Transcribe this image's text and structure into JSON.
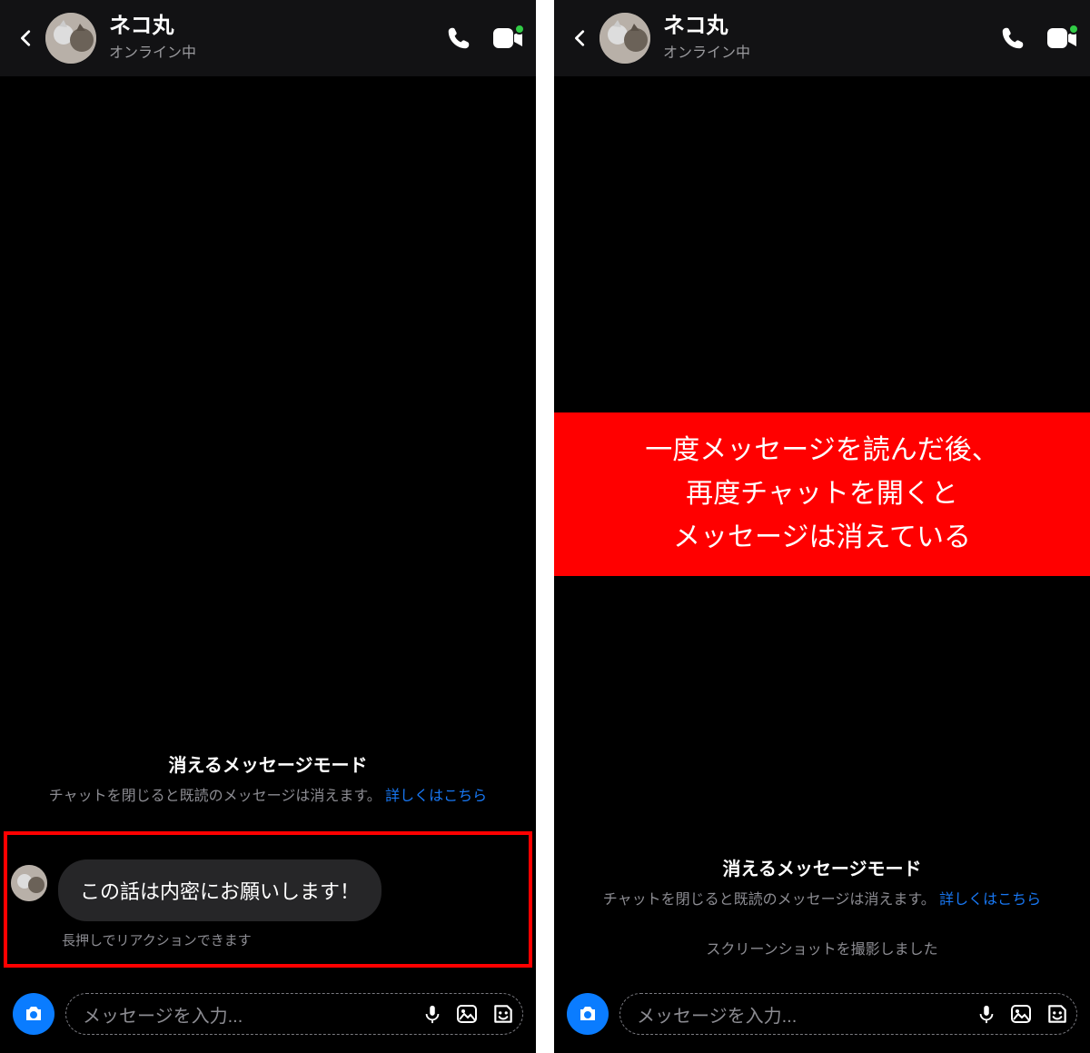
{
  "screens": [
    {
      "header": {
        "username": "ネコ丸",
        "status": "オンライン中"
      },
      "vanish": {
        "title": "消えるメッセージモード",
        "desc_prefix": "チャットを閉じると既読のメッセージは消えます。",
        "link": "詳しくはこちら"
      },
      "message": {
        "bubble": "この話は内密にお願いします！",
        "hint": "長押しでリアクションできます"
      },
      "input_placeholder": "メッセージを入力...",
      "highlight_box": true
    },
    {
      "header": {
        "username": "ネコ丸",
        "status": "オンライン中"
      },
      "vanish": {
        "title": "消えるメッセージモード",
        "desc_prefix": "チャットを閉じると既読のメッセージは消えます。",
        "link": "詳しくはこちら"
      },
      "screenshot_hint": "スクリーンショットを撮影しました",
      "input_placeholder": "メッセージを入力...",
      "annotation": {
        "line1": "一度メッセージを読んだ後、",
        "line2": "再度チャットを開くと",
        "line3": "メッセージは消えている"
      }
    }
  ],
  "icons": {
    "back": "chevron-left",
    "call": "phone",
    "video": "video-camera",
    "camera": "camera",
    "mic": "microphone",
    "image": "image",
    "sticker": "sticker"
  },
  "colors": {
    "accent_blue": "#0a7cff",
    "link_blue": "#1877f2",
    "annotation_red": "#ff0000",
    "online_green": "#31cc46"
  }
}
